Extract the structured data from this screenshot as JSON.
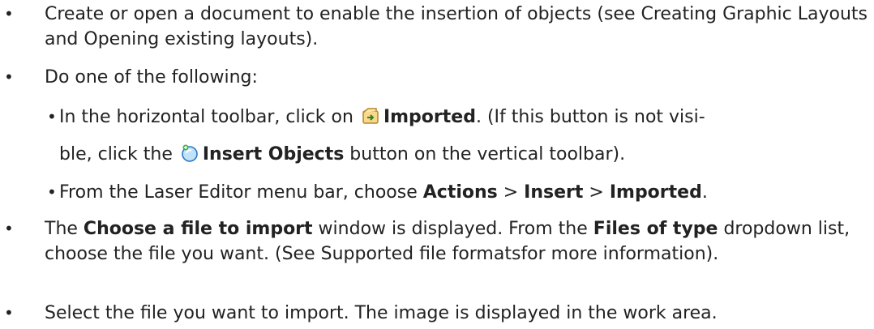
{
  "steps": [
    {
      "bullet": "•",
      "text1": "Create or open a document to enable the insertion of objects (see ",
      "link1": "Creating Graphic Layouts",
      "text2": " and ",
      "link2": "Opening existing layouts",
      "text3": ")."
    },
    {
      "bullet": "•",
      "text": "Do one of the following:"
    },
    {
      "bullet": "•",
      "text1": "In the horizontal toolbar, click on ",
      "icon1": "imported-icon",
      "bold1": "Imported",
      "text2": ". (If this button is not visi-",
      "text3": "ble, click the ",
      "icon2": "insert-objects-icon",
      "bold2": "Insert Objects",
      "text4": " button on the vertical toolbar)."
    },
    {
      "bullet": "•",
      "text1": "From the Laser Editor menu bar, choose ",
      "bold1": "Actions",
      "sep1": " > ",
      "bold2": "Insert",
      "sep2": " > ",
      "bold3": "Imported",
      "text2": "."
    },
    {
      "bullet": "•",
      "text1": "The ",
      "bold1": "Choose a file to import",
      "text2": " window is displayed. From the ",
      "bold2": "Files of type",
      "text3": " dropdown list, choose the file you want. (See ",
      "link1": "Supported file formats",
      "text4": "for more information)."
    },
    {
      "bullet": "•",
      "text": "Select the file you want to import. The image is displayed in the work area."
    }
  ]
}
